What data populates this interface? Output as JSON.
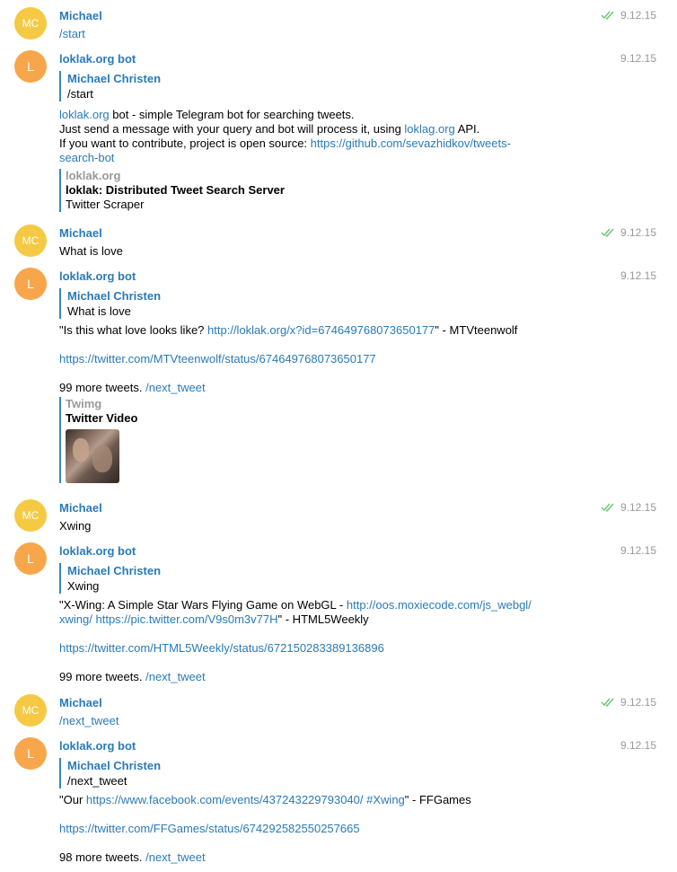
{
  "colors": {
    "accent": "#2a7ab8",
    "check": "#6bc46d",
    "avatar_mc": "#f5c943",
    "avatar_l": "#f8a64b"
  },
  "m1": {
    "avatar": "MC",
    "name": "Michael",
    "text": "/start",
    "time": "9.12.15",
    "status_icon": "double-check-icon"
  },
  "m2": {
    "avatar": "L",
    "name": "loklak.org bot",
    "time": "9.12.15",
    "reply_name": "Michael Christen",
    "reply_text": "/start",
    "l1_link": "loklak.org",
    "l1_text": " bot - simple Telegram bot for searching tweets.",
    "l2_text": "Just send a message with your query and bot will process it, using ",
    "l2_link": "loklag.org",
    "l2_end": " API.",
    "l3_text": "If you want to contribute, project is open source: ",
    "l3_link": "https://github.com/sevazhidkov/tweets-search-bot",
    "preview_source": "loklak.org",
    "preview_title": "loklak: Distributed Tweet Search Server",
    "preview_desc": "Twitter Scraper"
  },
  "m3": {
    "avatar": "MC",
    "name": "Michael",
    "text": "What is love",
    "time": "9.12.15",
    "status_icon": "double-check-icon"
  },
  "m4": {
    "avatar": "L",
    "name": "loklak.org bot",
    "time": "9.12.15",
    "reply_name": "Michael Christen",
    "reply_text": "What is love",
    "t1_pre": "\"Is this what love looks like? ",
    "t1_link": "http://loklak.org/x?id=674649768073650177",
    "t1_post": "\" - MTVteenwolf",
    "status_link": "https://twitter.com/MTVteenwolf/status/674649768073650177",
    "more_text": "99 more tweets. ",
    "more_link": "/next_tweet",
    "preview_source": "Twimg",
    "preview_title": "Twitter Video",
    "thumb_icon": "video-thumbnail"
  },
  "m5": {
    "avatar": "MC",
    "name": "Michael",
    "text": "Xwing",
    "time": "9.12.15",
    "status_icon": "double-check-icon"
  },
  "m6": {
    "avatar": "L",
    "name": "loklak.org bot",
    "time": "9.12.15",
    "reply_name": "Michael Christen",
    "reply_text": "Xwing",
    "t1_pre": "\"X-Wing: A Simple Star Wars Flying Game on WebGL - ",
    "t1_link": "http://oos.moxiecode.com/js_webgl/",
    "t2_link1": "xwing/",
    "t2_link2": "https://pic.twitter.com/V9s0m3v77H",
    "t2_post": "\" - HTML5Weekly",
    "status_link": "https://twitter.com/HTML5Weekly/status/672150283389136896",
    "more_text": "99 more tweets. ",
    "more_link": "/next_tweet"
  },
  "m7": {
    "avatar": "MC",
    "name": "Michael",
    "text": "/next_tweet",
    "time": "9.12.15",
    "status_icon": "double-check-icon"
  },
  "m8": {
    "avatar": "L",
    "name": "loklak.org bot",
    "time": "9.12.15",
    "reply_name": "Michael Christen",
    "reply_text": "/next_tweet",
    "t1_pre": "\"Our ",
    "t1_link": "https://www.facebook.com/events/437243229793040/",
    "t1_hash": "#Xwing",
    "t1_post": "\" - FFGames",
    "status_link": "https://twitter.com/FFGames/status/674292582550257665",
    "more_text": "98 more tweets. ",
    "more_link": "/next_tweet"
  }
}
